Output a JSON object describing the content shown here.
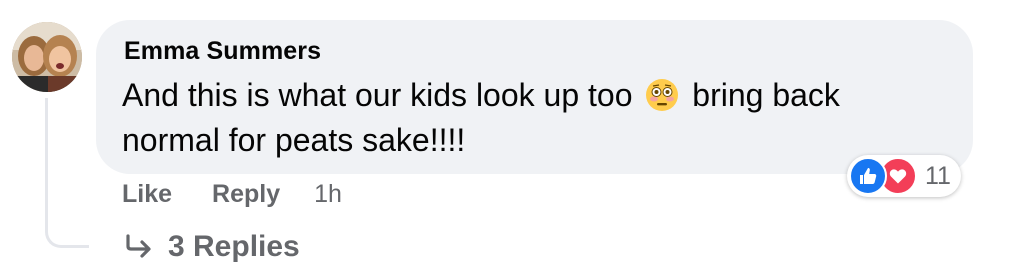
{
  "comment": {
    "author": "Emma Summers",
    "text_before_emoji": "And this is what our kids look up too",
    "emoji": "flushed-face",
    "text_after_emoji": "bring back normal for peats sake!!!!",
    "timestamp": "1h"
  },
  "actions": {
    "like_label": "Like",
    "reply_label": "Reply"
  },
  "reactions": {
    "types": [
      "like",
      "love"
    ],
    "count": "11",
    "colors": {
      "like": "#1877f2",
      "love": "#f33e58"
    }
  },
  "replies": {
    "label": "3 Replies",
    "icon": "reply-arrow-icon"
  },
  "colors": {
    "bubble_bg": "#f0f2f5",
    "secondary_text": "#65676b",
    "primary_text": "#050505",
    "thread_line": "#e4e6eb"
  }
}
